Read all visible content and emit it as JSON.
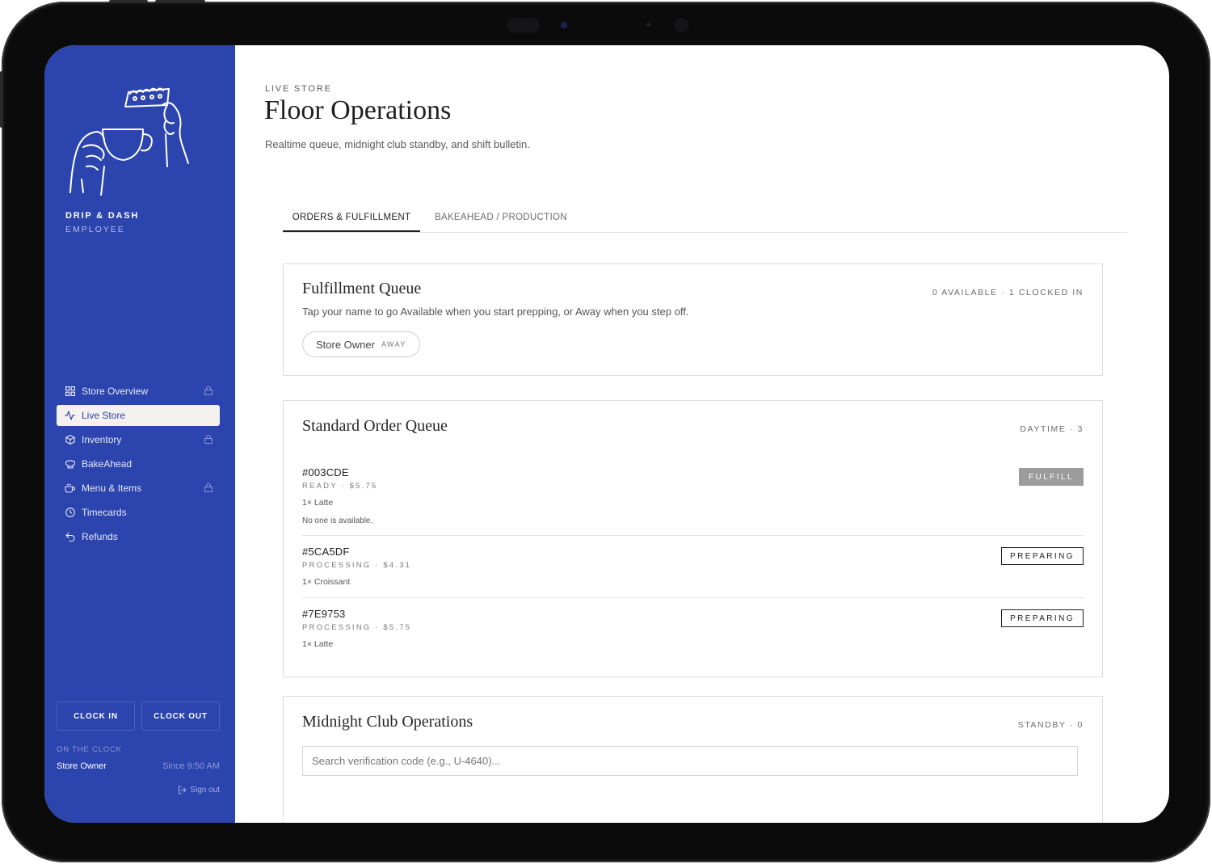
{
  "sidebar": {
    "brand": "DRIP & DASH",
    "brand_sub": "EMPLOYEE",
    "nav": [
      {
        "label": "Store Overview",
        "icon": "grid-icon",
        "locked": true,
        "active": false
      },
      {
        "label": "Live Store",
        "icon": "activity-icon",
        "locked": false,
        "active": true
      },
      {
        "label": "Inventory",
        "icon": "box-icon",
        "locked": true,
        "active": false
      },
      {
        "label": "BakeAhead",
        "icon": "chef-hat-icon",
        "locked": false,
        "active": false
      },
      {
        "label": "Menu & Items",
        "icon": "coffee-cup-icon",
        "locked": true,
        "active": false
      },
      {
        "label": "Timecards",
        "icon": "clock-icon",
        "locked": false,
        "active": false
      },
      {
        "label": "Refunds",
        "icon": "undo-icon",
        "locked": false,
        "active": false
      }
    ],
    "clock_in": "CLOCK IN",
    "clock_out": "CLOCK OUT",
    "on_clock_label": "ON THE CLOCK",
    "on_clock_name": "Store Owner",
    "on_clock_since": "Since 9:50 AM",
    "sign_out": "Sign out"
  },
  "header": {
    "eyebrow": "LIVE STORE",
    "title": "Floor Operations",
    "subtitle": "Realtime queue, midnight club standby, and shift bulletin."
  },
  "tabs": [
    {
      "label": "ORDERS & FULFILLMENT",
      "active": true
    },
    {
      "label": "BAKEAHEAD / PRODUCTION",
      "active": false
    }
  ],
  "fulfillment": {
    "title": "Fulfillment Queue",
    "meta": "0 AVAILABLE · 1 CLOCKED IN",
    "description": "Tap your name to go Available when you start prepping, or Away when you step off.",
    "staff_name": "Store Owner",
    "staff_status": "AWAY"
  },
  "standard_queue": {
    "title": "Standard Order Queue",
    "meta": "DAYTIME · 3",
    "orders": [
      {
        "id": "#003CDE",
        "meta": "READY · $5.75",
        "items": "1× Latte",
        "note": "No one is available.",
        "action": "FULFILL"
      },
      {
        "id": "#5CA5DF",
        "meta": "PROCESSING · $4.31",
        "items": "1× Croissant",
        "action": "PREPARING"
      },
      {
        "id": "#7E9753",
        "meta": "PROCESSING · $5.75",
        "items": "1× Latte",
        "action": "PREPARING"
      }
    ]
  },
  "midnight": {
    "title": "Midnight Club Operations",
    "meta": "STANDBY · 0",
    "search_placeholder": "Search verification code (e.g., U-4640)..."
  },
  "colors": {
    "sidebar_bg": "#2c44ad",
    "active_nav_bg": "#f4f1ee",
    "fulfill_button": "#9c9c9c",
    "bezel": "#0b0b0c"
  }
}
